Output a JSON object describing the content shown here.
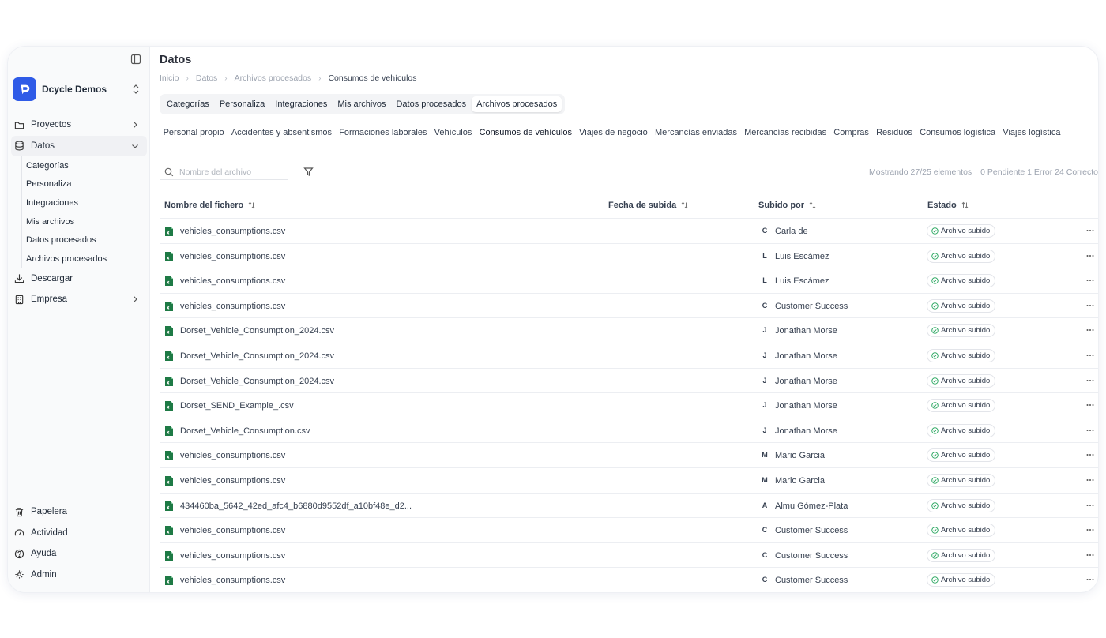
{
  "sidebar": {
    "org_name": "Dcycle Demos",
    "items": [
      {
        "label": "Proyectos",
        "icon": "folder-icon"
      },
      {
        "label": "Datos",
        "icon": "database-icon"
      },
      {
        "label": "Descargar",
        "icon": "download-icon"
      },
      {
        "label": "Empresa",
        "icon": "building-icon"
      }
    ],
    "datos_sub": [
      "Categorías",
      "Personaliza",
      "Integraciones",
      "Mis archivos",
      "Datos procesados",
      "Archivos procesados"
    ],
    "bottom_items": [
      {
        "label": "Papelera",
        "icon": "trash-icon"
      },
      {
        "label": "Actividad",
        "icon": "activity-icon"
      },
      {
        "label": "Ayuda",
        "icon": "help-icon"
      },
      {
        "label": "Admin",
        "icon": "gear-icon"
      }
    ]
  },
  "header": {
    "title": "Datos",
    "breadcrumbs": [
      "Inicio",
      "Datos",
      "Archivos procesados",
      "Consumos de vehículos"
    ]
  },
  "tabs_primary": [
    "Categorías",
    "Personaliza",
    "Integraciones",
    "Mis archivos",
    "Datos procesados",
    "Archivos procesados"
  ],
  "tabs_primary_active": 5,
  "tabs_secondary": [
    "Personal propio",
    "Accidentes y absentismos",
    "Formaciones laborales",
    "Vehículos",
    "Consumos de vehículos",
    "Viajes de negocio",
    "Mercancías enviadas",
    "Mercancías recibidas",
    "Compras",
    "Residuos",
    "Consumos logística",
    "Viajes logística"
  ],
  "tabs_secondary_active": 4,
  "search": {
    "placeholder": "Nombre del archivo",
    "value": ""
  },
  "summary": {
    "showing": "Mostrando 27/25 elementos",
    "status": "0 Pendiente 1 Error 24 Correcto"
  },
  "table": {
    "columns": [
      "Nombre del fichero",
      "Fecha de subida",
      "Subido por",
      "Estado"
    ],
    "rows": [
      {
        "file": "vehicles_consumptions.csv",
        "initial": "C",
        "user": "Carla de",
        "status": "Archivo subido"
      },
      {
        "file": "vehicles_consumptions.csv",
        "initial": "L",
        "user": "Luis Escámez",
        "status": "Archivo subido"
      },
      {
        "file": "vehicles_consumptions.csv",
        "initial": "L",
        "user": "Luis Escámez",
        "status": "Archivo subido"
      },
      {
        "file": "vehicles_consumptions.csv",
        "initial": "C",
        "user": "Customer Success",
        "status": "Archivo subido"
      },
      {
        "file": "Dorset_Vehicle_Consumption_2024.csv",
        "initial": "J",
        "user": "Jonathan Morse",
        "status": "Archivo subido"
      },
      {
        "file": "Dorset_Vehicle_Consumption_2024.csv",
        "initial": "J",
        "user": "Jonathan Morse",
        "status": "Archivo subido"
      },
      {
        "file": "Dorset_Vehicle_Consumption_2024.csv",
        "initial": "J",
        "user": "Jonathan Morse",
        "status": "Archivo subido"
      },
      {
        "file": "Dorset_SEND_Example_.csv",
        "initial": "J",
        "user": "Jonathan Morse",
        "status": "Archivo subido"
      },
      {
        "file": "Dorset_Vehicle_Consumption.csv",
        "initial": "J",
        "user": "Jonathan Morse",
        "status": "Archivo subido"
      },
      {
        "file": "vehicles_consumptions.csv",
        "initial": "M",
        "user": "Mario Garcia",
        "status": "Archivo subido"
      },
      {
        "file": "vehicles_consumptions.csv",
        "initial": "M",
        "user": "Mario Garcia",
        "status": "Archivo subido"
      },
      {
        "file": "434460ba_5642_42ed_afc4_b6880d9552df_a10bf48e_d2...",
        "initial": "A",
        "user": "Almu Gómez-Plata",
        "status": "Archivo subido"
      },
      {
        "file": "vehicles_consumptions.csv",
        "initial": "C",
        "user": "Customer Success",
        "status": "Archivo subido"
      },
      {
        "file": "vehicles_consumptions.csv",
        "initial": "C",
        "user": "Customer Success",
        "status": "Archivo subido"
      },
      {
        "file": "vehicles_consumptions.csv",
        "initial": "C",
        "user": "Customer Success",
        "status": "Archivo subido"
      }
    ]
  },
  "colors": {
    "brand": "#2f5be7",
    "success": "#22a35a",
    "file_icon": "#1e7a45"
  }
}
